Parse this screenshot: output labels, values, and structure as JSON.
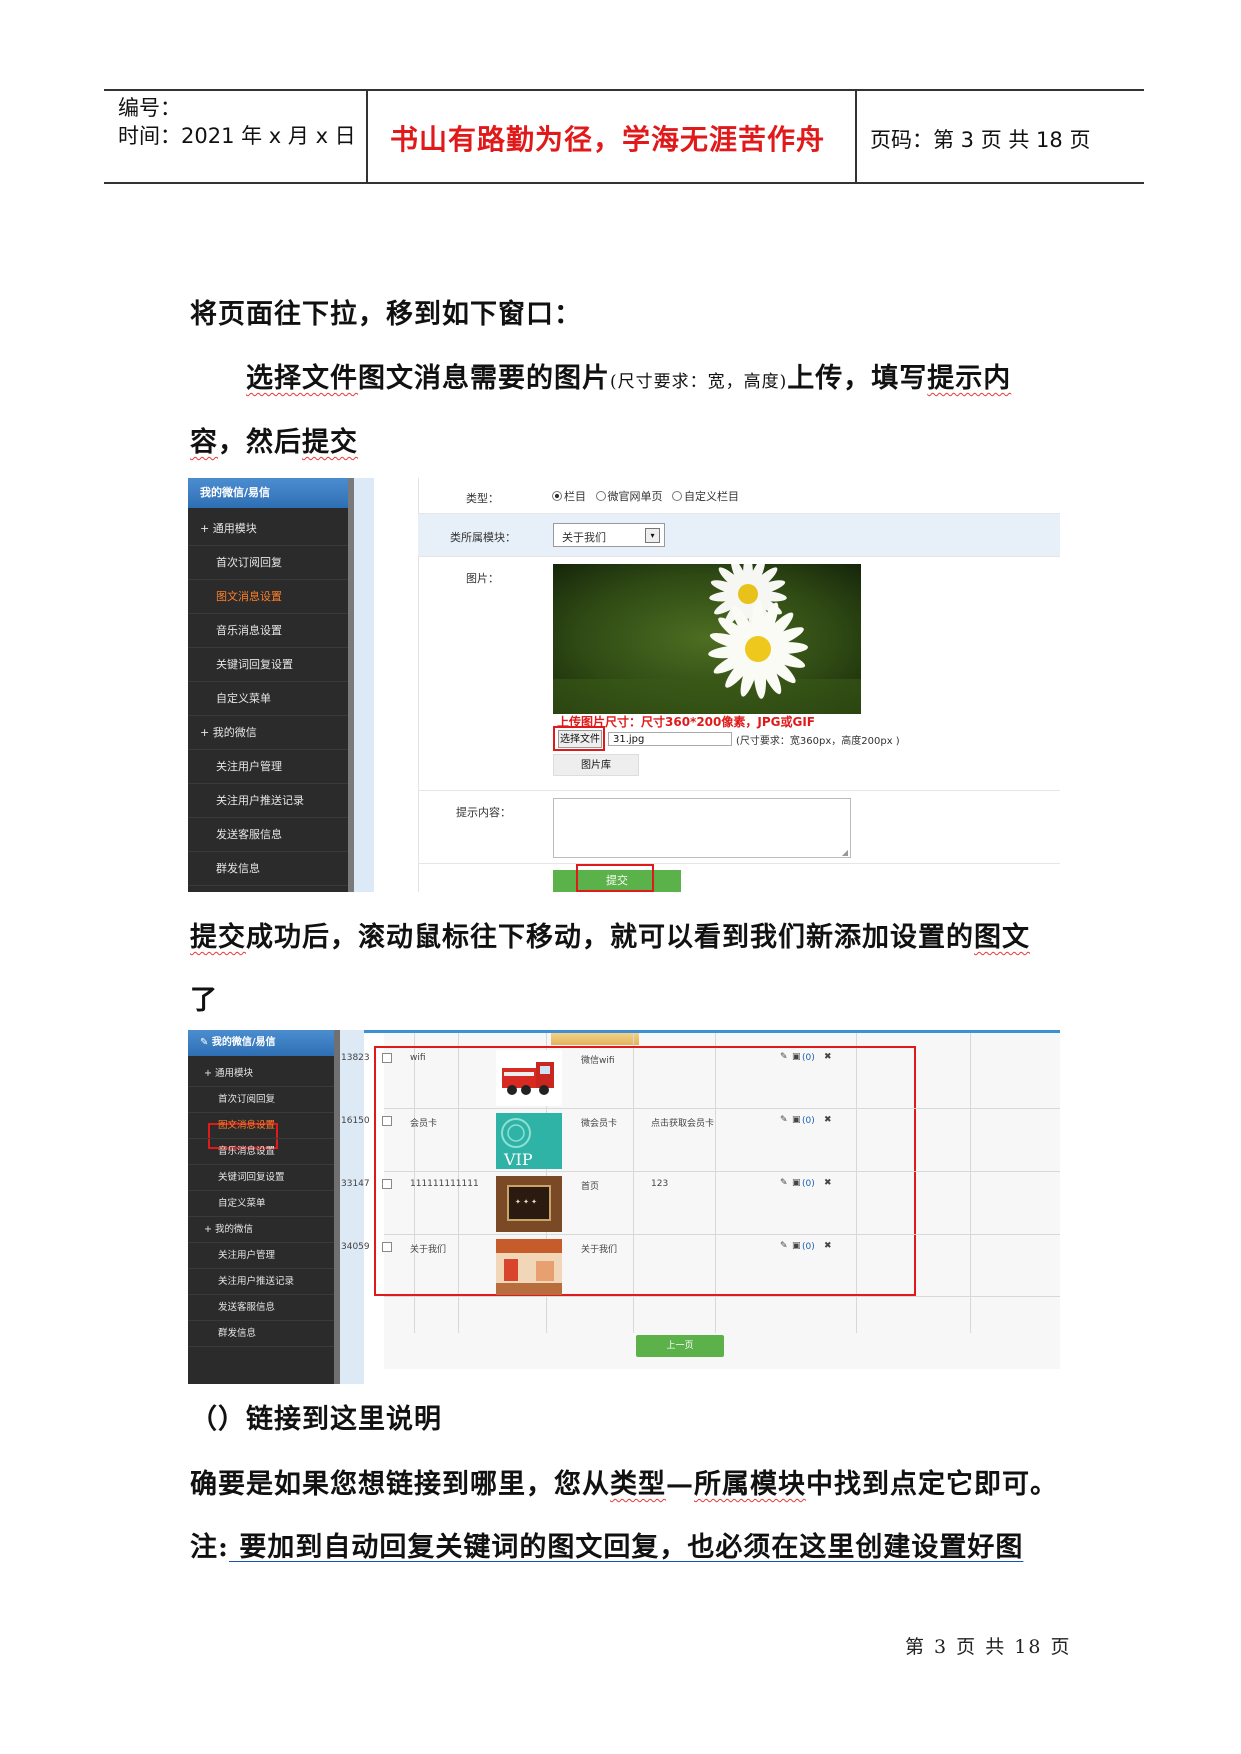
{
  "header": {
    "number_label": "编号：",
    "time_label": "时间：2021 年 x 月 x 日",
    "motto": "书山有路勤为径，学海无涯苦作舟",
    "page_label": "页码：第 3 页  共 18 页"
  },
  "body": {
    "p1": "将页面往下拉，移到如下窗口：",
    "p2_a": "选择文件",
    "p2_b": "图文消息需要的图片",
    "p2_note": "(尺寸要求：宽，高度)",
    "p2_c": "上传，填写",
    "p2_d": "提示内",
    "p3_a": "容",
    "p3_b": "，然后",
    "p3_c": "提交",
    "p4_a": "提交",
    "p4_b": "成功后，滚动鼠标往下移动，就可以看到我们新添加设置的",
    "p4_c": "图文",
    "p5": "了",
    "p6": "（）链接到这里说明",
    "p7_a": "确要是如果您想链接到哪里，您从",
    "p7_b": "类型",
    "p7_c": "—",
    "p7_d": "所属模块",
    "p7_e": "中找到点定它即可。",
    "p8_a": "注:",
    "p8_b": " 要加到自动回复关键词的图文回复，也必须在这里创建设置好图"
  },
  "screenshot1": {
    "sidebar_title": "我的微信/易信",
    "sidebar_items": [
      "+ 通用模块",
      "首次订阅回复",
      "图文消息设置",
      "音乐消息设置",
      "关键词回复设置",
      "自定义菜单",
      "+ 我的微信",
      "关注用户管理",
      "关注用户推送记录",
      "发送客服信息",
      "群发信息"
    ],
    "type_label": "类型：",
    "type_options": [
      "栏目",
      "微官网单页",
      "自定义栏目"
    ],
    "module_label": "类所属模块：",
    "module_value": "关于我们",
    "image_label": "图片：",
    "upload_hint": "上传图片尺寸：尺寸360*200像素，JPG或GIF",
    "choose_file": "选择文件",
    "file_name": "31.jpg",
    "size_req": "(尺寸要求：宽360px，高度200px )",
    "gallery_btn": "图片库",
    "tip_label": "提示内容：",
    "submit_btn": "提交"
  },
  "screenshot2": {
    "sidebar_title": "我的微信/易信",
    "sidebar_items": [
      "+ 通用模块",
      "首次订阅回复",
      "图文消息设置",
      "音乐消息设置",
      "关键词回复设置",
      "自定义菜单",
      "+ 我的微信",
      "关注用户管理",
      "关注用户推送记录",
      "发送客服信息",
      "群发信息"
    ],
    "rows": [
      {
        "id": "13823",
        "name": "wifi",
        "title": "微信wifi",
        "desc": "",
        "count": "(0)"
      },
      {
        "id": "16150",
        "name": "会员卡",
        "title": "微会员卡",
        "desc": "点击获取会员卡",
        "count": "(0)"
      },
      {
        "id": "33147",
        "name": "111111111111",
        "title": "首页",
        "desc": "123",
        "count": "(0)"
      },
      {
        "id": "34059",
        "name": "关于我们",
        "title": "关于我们",
        "desc": "",
        "count": "(0)"
      }
    ],
    "vip_text": "VIP",
    "prev_btn": "上一页"
  },
  "footer": "第 3 页 共 18 页"
}
